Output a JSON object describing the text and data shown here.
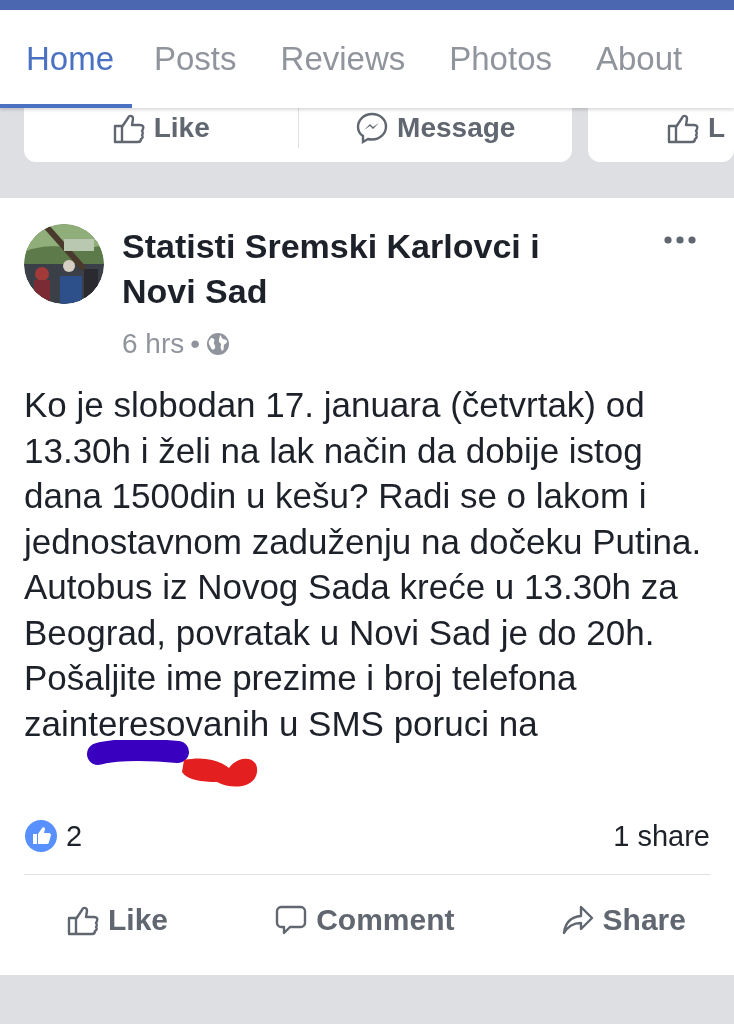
{
  "tabs": [
    {
      "label": "Home",
      "selected": true
    },
    {
      "label": "Posts",
      "selected": false
    },
    {
      "label": "Reviews",
      "selected": false
    },
    {
      "label": "Photos",
      "selected": false
    },
    {
      "label": "About",
      "selected": false
    }
  ],
  "page_actions": [
    {
      "kind": "like",
      "label": "Like"
    },
    {
      "kind": "message",
      "label": "Message"
    },
    {
      "kind": "like",
      "label": "L"
    }
  ],
  "post": {
    "author": "Statisti Sremski Karlovci i Novi Sad",
    "time": "6 hrs",
    "separator": "•",
    "body": "Ko je slobodan 17. januara (četvrtak) od 13.30h i želi na lak način da dobije istog dana 1500din u kešu? Radi se o lakom i jednostavnom zaduženju na dočeku Putina. Autobus iz Novog Sada kreće u 13.30h za Beograd, povratak u Novi Sad je do 20h. Pošaljite ime prezime i broj telefona zainteresovanih u SMS poruci na",
    "reactions": "2",
    "shares": "1 share",
    "actions": [
      {
        "kind": "like",
        "label": "Like"
      },
      {
        "kind": "comment",
        "label": "Comment"
      },
      {
        "kind": "share",
        "label": "Share"
      }
    ]
  }
}
